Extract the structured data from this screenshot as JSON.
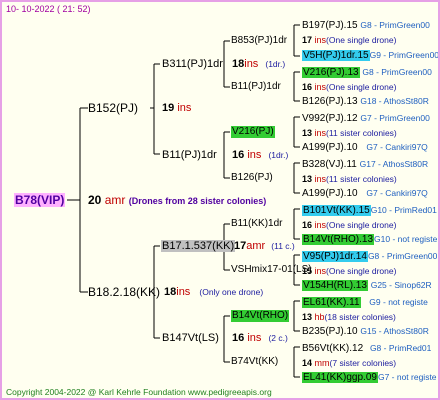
{
  "header": {
    "date": "10-  10-2022  ( 21:  52)"
  },
  "footer": {
    "copyright": "Copyright 2004-2022 @ Karl Kehrle Foundation    www.pedigreeapis.org"
  },
  "colors": {
    "border": "#e6a0e6",
    "green": "#33cc33",
    "cyan": "#33ccee",
    "gray": "#c0c0c0",
    "root_bg": "#ffb0ff"
  },
  "root": {
    "id": "B78(VIP)",
    "age": "20",
    "unit": "amr",
    "note": "(Drones from 28 sister colonies)"
  },
  "gen1": [
    {
      "id": "B152(PJ)",
      "age": "19",
      "unit": "ins"
    },
    {
      "id": "B18.2.18(KK)",
      "age": "18",
      "unit": "ins",
      "note": "(Only one drone)"
    }
  ],
  "gen2": [
    {
      "id": "B311(PJ)1dr",
      "age": "18",
      "unit": "ins",
      "note": "(1dr.)"
    },
    {
      "id": "B11(PJ)1dr",
      "age": "16",
      "unit": "ins",
      "note": "(1dr.)"
    },
    {
      "id": "B17.1.537(KK)",
      "age": "17",
      "unit": "amr",
      "note": "(11 c.)"
    },
    {
      "id": "B147Vt(LS)",
      "age": "16",
      "unit": "ins",
      "note": "(2 c.)"
    }
  ],
  "gen3": [
    {
      "id": "B853(PJ)1dr"
    },
    {
      "id": "B11(PJ)1dr"
    },
    {
      "id": "V216(PJ)"
    },
    {
      "id": "B126(PJ)"
    },
    {
      "id": "B11(KK)1dr",
      "age": "16",
      "unit": "ins",
      "note": "(One single drone)"
    },
    {
      "id": "VSHmix17-01(LS)"
    },
    {
      "id": "B14Vt(RHO)"
    },
    {
      "id": "B74Vt(KK)"
    }
  ],
  "gen4": [
    {
      "id": "B197(PJ).15",
      "ped": "G8 - PrimGreen00"
    },
    {
      "age": "17",
      "unit": "ins",
      "note": "(One single drone)"
    },
    {
      "id": "V5H(PJ)1dr.15",
      "ped": "G9 - PrimGreen00"
    },
    {
      "id": "V216(PJ).13",
      "ped": "G8 - PrimGreen00"
    },
    {
      "age": "16",
      "unit": "ins",
      "note": "(One single drone)"
    },
    {
      "id": "B126(PJ).13",
      "ped": "G18 - AthosSt80R"
    },
    {
      "id": "V992(PJ).12",
      "ped": "G7 - PrimGreen00"
    },
    {
      "age": "13",
      "unit": "ins",
      "note": "(11 sister colonies)"
    },
    {
      "id": "A199(PJ).10",
      "ped": "G7 - Cankiri97Q"
    },
    {
      "id": "B328(VJ).11",
      "ped": "G17 - AthosSt80R"
    },
    {
      "age": "13",
      "unit": "ins",
      "note": "(11 sister colonies)"
    },
    {
      "id": "A199(PJ).10",
      "ped": "G7 - Cankiri97Q"
    },
    {
      "id": "B101Vt(KK).15",
      "ped": "G10 - PrimRed01"
    },
    {
      "age": "16",
      "unit": "ins",
      "note": "(One single drone)"
    },
    {
      "id": "B14Vt(RHO).13",
      "ped": "G10 - not registe"
    },
    {
      "id": "V95(PJ)1dr.14",
      "ped": "G8 - PrimGreen00"
    },
    {
      "age": "15",
      "unit": "ins",
      "note": "(One single drone)"
    },
    {
      "id": "V154H(RL).13",
      "ped": "G25 - Sinop62R"
    },
    {
      "id": "EL61(KK).11",
      "ped": "G9 - not registe"
    },
    {
      "age": "13",
      "unit": "hb",
      "note": "(18 sister colonies)"
    },
    {
      "id": "B235(PJ).10",
      "ped": "G15 - AthosSt80R"
    },
    {
      "id": "B56Vt(KK).12",
      "ped": "G8 - PrimRed01"
    },
    {
      "age": "14",
      "unit": "mm",
      "note": "(7 sister colonies)"
    },
    {
      "id": "EL41(KK)ggp.09",
      "ped": "G7 - not registe"
    }
  ]
}
